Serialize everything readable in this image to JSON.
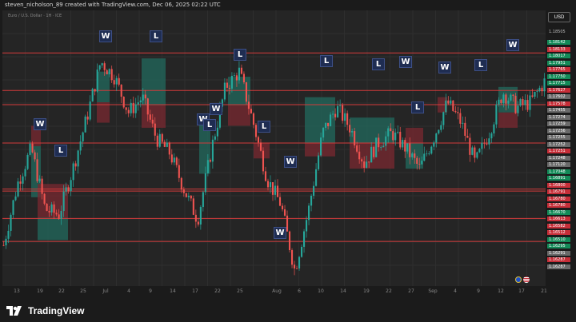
{
  "header": {
    "title": "steven_nicholson_89 created with TradingView.com, Dec 06, 2025 02:22 UTC"
  },
  "symbol": "Euro / U.S. Dollar · 1H · ICE",
  "currency_button": "USD",
  "brand": {
    "name": "TradingView"
  },
  "colors": {
    "background": "#252525",
    "up": "#26a69a",
    "down": "#ef5350",
    "level_line": "#d33b3b",
    "buy_zone": "#22695d",
    "sell_zone": "#7a2830",
    "marker_bg": "#1f2d52",
    "label_red": "#c62e38",
    "label_green": "#138a58",
    "label_gray": "#6a6a6a"
  },
  "price_axis": {
    "top_label": "1.18505",
    "labels": [
      {
        "value": "1.18142",
        "color": "green"
      },
      {
        "value": "1.18133",
        "color": "red"
      },
      {
        "value": "1.18017",
        "color": "green"
      },
      {
        "value": "1.17951",
        "color": "green"
      },
      {
        "value": "1.17765",
        "color": "red"
      },
      {
        "value": "1.17750",
        "color": "green"
      },
      {
        "value": "1.17715",
        "color": "green"
      },
      {
        "value": "1.17627",
        "color": "red"
      },
      {
        "value": "1.17602",
        "color": "gray"
      },
      {
        "value": "1.17578",
        "color": "red"
      },
      {
        "value": "1.17455",
        "color": "gray"
      },
      {
        "value": "1.17274",
        "color": "gray"
      },
      {
        "value": "1.17259",
        "color": "gray"
      },
      {
        "value": "1.17256",
        "color": "gray"
      },
      {
        "value": "1.17255",
        "color": "gray"
      },
      {
        "value": "1.17252",
        "color": "gray"
      },
      {
        "value": "1.17251",
        "color": "red"
      },
      {
        "value": "1.17248",
        "color": "gray"
      },
      {
        "value": "1.17120",
        "color": "gray"
      },
      {
        "value": "1.17048",
        "color": "green"
      },
      {
        "value": "1.16891",
        "color": "green"
      },
      {
        "value": "1.16800",
        "color": "red"
      },
      {
        "value": "1.16791",
        "color": "red"
      },
      {
        "value": "1.16780",
        "color": "red"
      },
      {
        "value": "1.16780",
        "color": "red"
      },
      {
        "value": "1.16670",
        "color": "green"
      },
      {
        "value": "1.16613",
        "color": "red"
      },
      {
        "value": "1.16582",
        "color": "red"
      },
      {
        "value": "1.16512",
        "color": "red"
      },
      {
        "value": "1.16510",
        "color": "green"
      },
      {
        "value": "1.16295",
        "color": "green"
      },
      {
        "value": "1.16291",
        "color": "gray"
      },
      {
        "value": "1.16287",
        "color": "red"
      },
      {
        "value": "1.16287",
        "color": "gray"
      }
    ]
  },
  "time_axis": [
    "13",
    "19",
    "22",
    "25",
    "Jul",
    "4",
    "9",
    "14",
    "17",
    "22",
    "25",
    "Aug",
    "6",
    "10",
    "14",
    "19",
    "22",
    "27",
    "Sep",
    "4",
    "9",
    "12",
    "17",
    "21"
  ],
  "markers": [
    {
      "text": "W",
      "id": "w1"
    },
    {
      "text": "L",
      "id": "l1"
    },
    {
      "text": "W",
      "id": "w2"
    },
    {
      "text": "L",
      "id": "l2"
    },
    {
      "text": "W",
      "id": "w3"
    },
    {
      "text": "L",
      "id": "l3"
    },
    {
      "text": "W",
      "id": "w4"
    },
    {
      "text": "L",
      "id": "l4"
    },
    {
      "text": "L",
      "id": "l5"
    },
    {
      "text": "W",
      "id": "w5"
    },
    {
      "text": "W",
      "id": "w6"
    },
    {
      "text": "L",
      "id": "l6"
    },
    {
      "text": "L",
      "id": "l7"
    },
    {
      "text": "W",
      "id": "w7"
    },
    {
      "text": "L",
      "id": "l8"
    },
    {
      "text": "W",
      "id": "w8"
    },
    {
      "text": "L",
      "id": "l9"
    },
    {
      "text": "W",
      "id": "w9"
    }
  ],
  "chart_data": {
    "type": "candlestick",
    "instrument": "EUR/USD",
    "ylim": [
      1.1585,
      1.1855
    ],
    "horizontal_levels": [
      1.18133,
      1.17765,
      1.17627,
      1.17251,
      1.168,
      1.1678,
      1.16512,
      1.16287
    ],
    "path": [
      1.1625,
      1.1685,
      1.172,
      1.166,
      1.1655,
      1.17,
      1.175,
      1.1805,
      1.179,
      1.1755,
      1.177,
      1.173,
      1.1715,
      1.168,
      1.165,
      1.172,
      1.178,
      1.1795,
      1.1745,
      1.169,
      1.1665,
      1.16,
      1.166,
      1.1735,
      1.176,
      1.174,
      1.1705,
      1.1725,
      1.1735,
      1.172,
      1.17,
      1.173,
      1.1765,
      1.1745,
      1.1705,
      1.1735,
      1.1775,
      1.176,
      1.1765,
      1.1785
    ]
  }
}
